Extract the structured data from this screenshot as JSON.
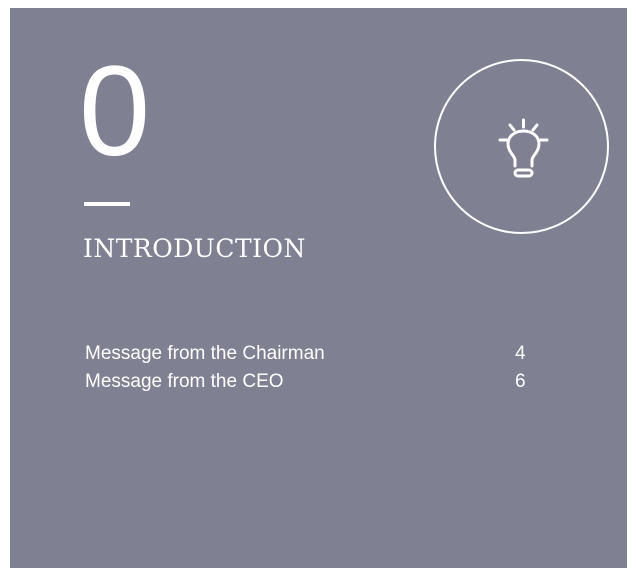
{
  "section": {
    "number": "0",
    "title": "INTRODUCTION",
    "icon": "lightbulb-icon"
  },
  "toc": {
    "items": [
      {
        "label": "Message from the Chairman",
        "page": "4"
      },
      {
        "label": "Message from the CEO",
        "page": "6"
      }
    ]
  },
  "colors": {
    "background": "#7f8193",
    "foreground": "#ffffff"
  }
}
